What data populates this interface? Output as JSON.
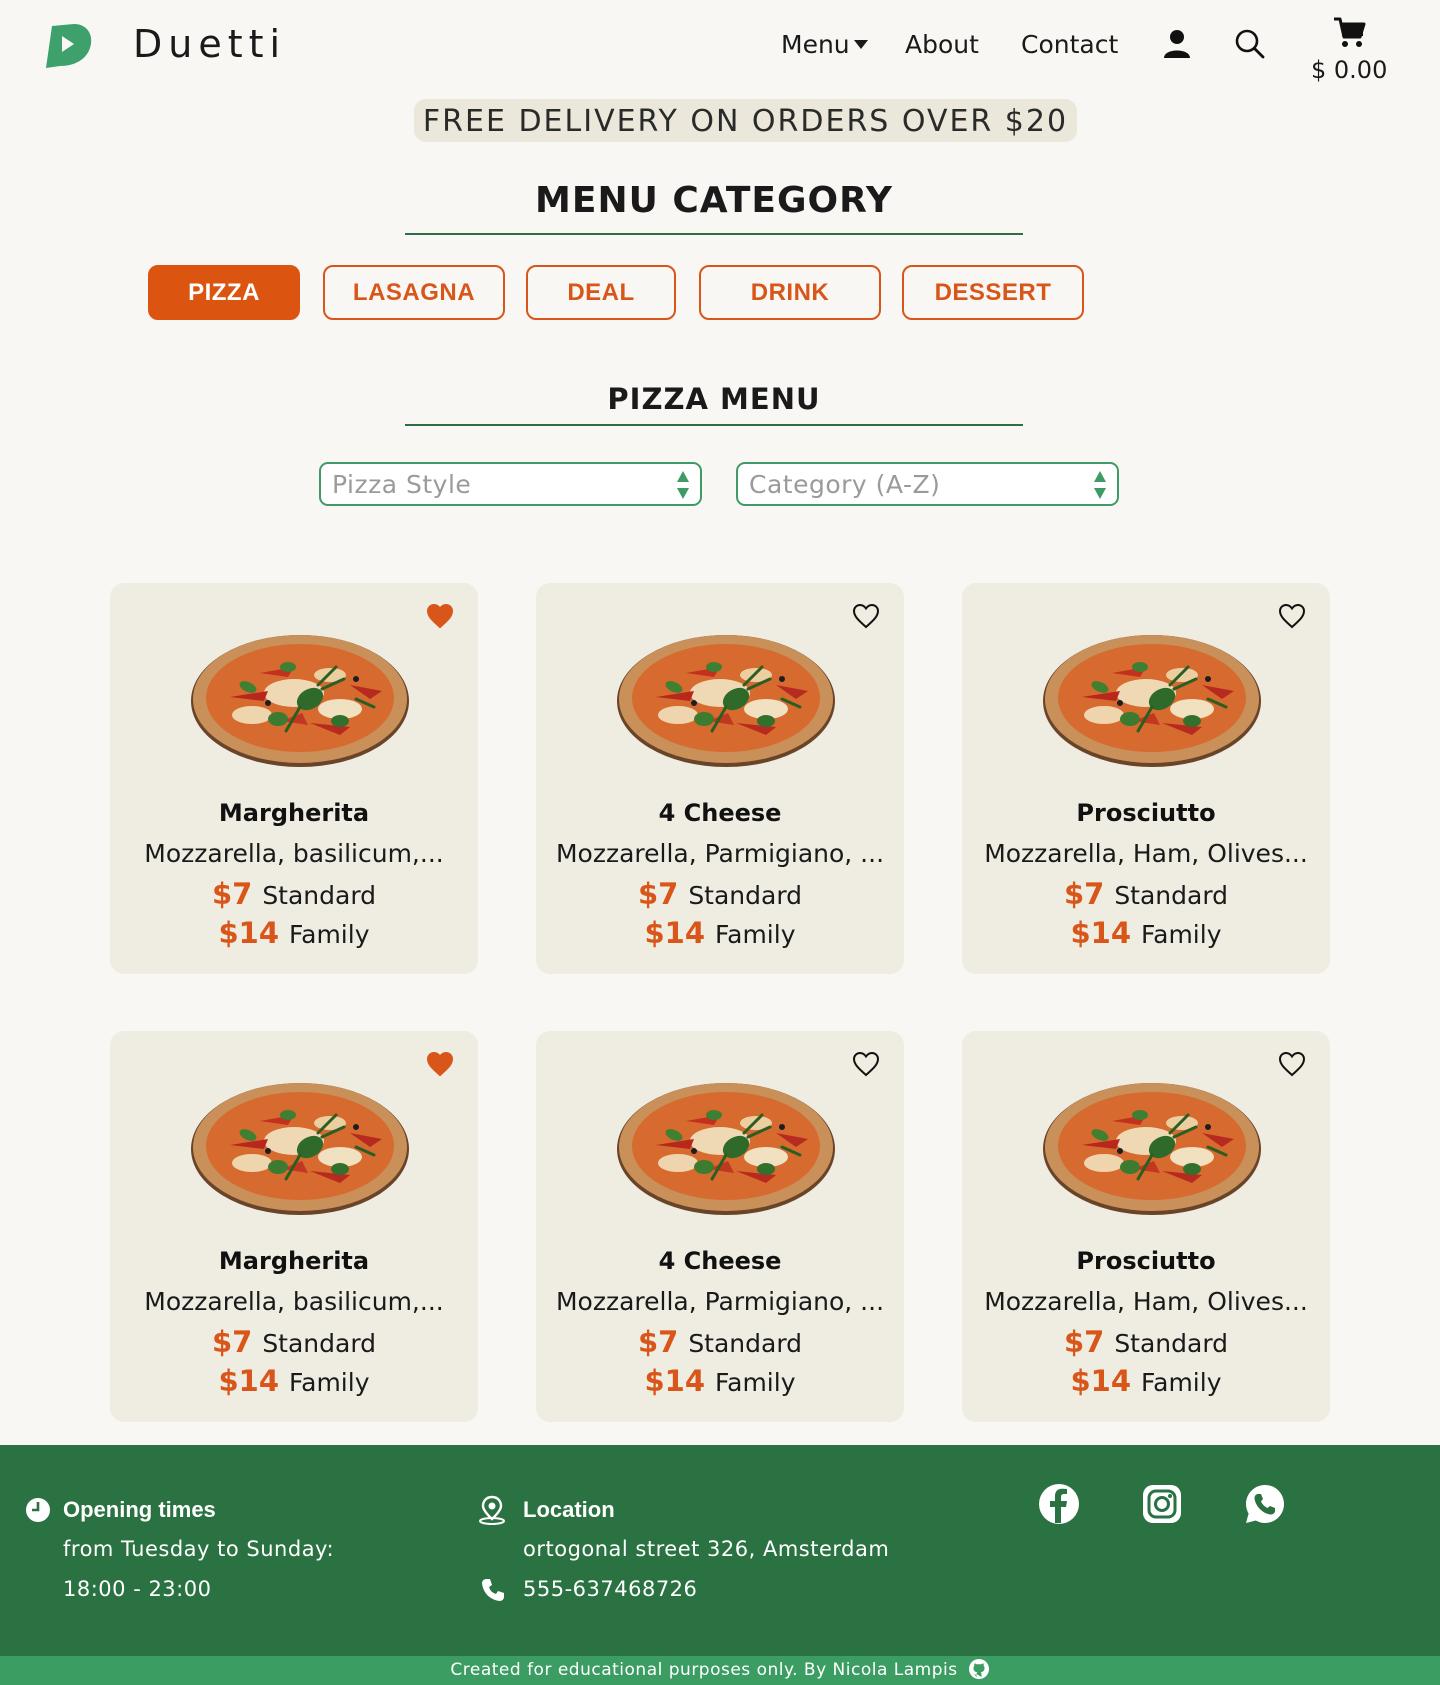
{
  "header": {
    "brand": "Duetti",
    "nav": {
      "menu": "Menu",
      "about": "About",
      "contact": "Contact"
    },
    "cart_total": "$ 0.00",
    "icons": {
      "logo": "duetti-d-logo",
      "user": "user-icon",
      "search": "search-icon",
      "cart": "cart-icon"
    },
    "colors": {
      "logo": "#3ea06a"
    }
  },
  "banner": {
    "text": "FREE DELIVERY ON ORDERS OVER $20"
  },
  "menu_category": {
    "title": "MENU CATEGORY",
    "buttons": [
      {
        "label": "PIZZA",
        "active": true
      },
      {
        "label": "LASAGNA",
        "active": false
      },
      {
        "label": "DEAL",
        "active": false
      },
      {
        "label": "DRINK",
        "active": false
      },
      {
        "label": "DESSERT",
        "active": false
      }
    ]
  },
  "pizza_menu": {
    "title": "PIZZA MENU",
    "filters": {
      "style_placeholder": "Pizza Style",
      "category_placeholder": "Category (A-Z)"
    },
    "items": [
      {
        "name": "Margherita",
        "desc": "Mozzarella, basilicum,...",
        "price_standard": "$7",
        "label_standard": "Standard",
        "price_family": "$14",
        "label_family": "Family",
        "favorite": true
      },
      {
        "name": "4 Cheese",
        "desc": "Mozzarella, Parmigiano, ...",
        "price_standard": "$7",
        "label_standard": "Standard",
        "price_family": "$14",
        "label_family": "Family",
        "favorite": false
      },
      {
        "name": "Prosciutto",
        "desc": "Mozzarella, Ham, Olives...",
        "price_standard": "$7",
        "label_standard": "Standard",
        "price_family": "$14",
        "label_family": "Family",
        "favorite": false
      },
      {
        "name": "Margherita",
        "desc": "Mozzarella, basilicum,...",
        "price_standard": "$7",
        "label_standard": "Standard",
        "price_family": "$14",
        "label_family": "Family",
        "favorite": true
      },
      {
        "name": "4 Cheese",
        "desc": "Mozzarella, Parmigiano, ...",
        "price_standard": "$7",
        "label_standard": "Standard",
        "price_family": "$14",
        "label_family": "Family",
        "favorite": false
      },
      {
        "name": "Prosciutto",
        "desc": "Mozzarella, Ham, Olives...",
        "price_standard": "$7",
        "label_standard": "Standard",
        "price_family": "$14",
        "label_family": "Family",
        "favorite": false
      }
    ]
  },
  "footer": {
    "opening_label": "Opening times",
    "opening_days": "from Tuesday to Sunday:",
    "opening_hours": "18:00 - 23:00",
    "location_label": "Location",
    "address": "ortogonal street 326, Amsterdam",
    "phone": "555-637468726",
    "social": [
      "facebook-icon",
      "instagram-icon",
      "whatsapp-icon"
    ],
    "credit": "Created for educational purposes only.  By Nicola Lampis"
  },
  "colors": {
    "accent": "#d8561a",
    "green": "#2a7242",
    "light_green": "#3b9d62",
    "card_bg": "#efece2"
  }
}
